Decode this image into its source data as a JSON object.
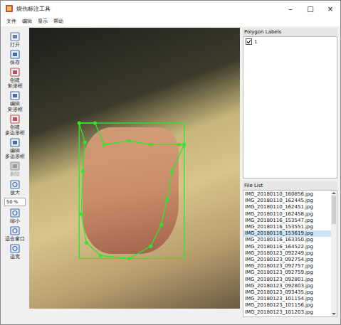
{
  "window": {
    "title": "烧伤标注工具",
    "controls": [
      "–",
      "□",
      "×"
    ]
  },
  "menu": [
    "文件",
    "编辑",
    "显示",
    "帮助"
  ],
  "toolbar": [
    {
      "label": "打开",
      "kind": "button",
      "disabled": false
    },
    {
      "label": "保存",
      "kind": "button",
      "disabled": false
    },
    {
      "label": "创建\n矩形框",
      "kind": "button",
      "disabled": false
    },
    {
      "label": "编辑\n矩形框",
      "kind": "button",
      "disabled": false
    },
    {
      "label": "创建\n多边形框",
      "kind": "button",
      "disabled": false
    },
    {
      "label": "编辑\n多边形框",
      "kind": "button",
      "disabled": false
    },
    {
      "label": "删除",
      "kind": "button",
      "disabled": true
    },
    {
      "label": "放大",
      "kind": "button",
      "disabled": false
    },
    {
      "label": "50 %",
      "kind": "spinbox",
      "disabled": false
    },
    {
      "label": "缩小",
      "kind": "button",
      "disabled": false
    },
    {
      "label": "适合窗口",
      "kind": "button",
      "disabled": false
    },
    {
      "label": "适宽",
      "kind": "button",
      "disabled": false
    }
  ],
  "labels_panel": {
    "title": "Polygon Labels",
    "items": [
      {
        "label": "1",
        "checked": true
      }
    ]
  },
  "file_list": {
    "title": "File List",
    "items": [
      {
        "name": "IMG_20180110_160856.jpg",
        "selected": false
      },
      {
        "name": "IMG_20180110_162445.jpg",
        "selected": false
      },
      {
        "name": "IMG_20180110_162451.jpg",
        "selected": false
      },
      {
        "name": "IMG_20180110_162458.jpg",
        "selected": false
      },
      {
        "name": "IMG_20180116_153547.jpg",
        "selected": false
      },
      {
        "name": "IMG_20180116_153551.jpg",
        "selected": false
      },
      {
        "name": "IMG_20180116_153619.jpg",
        "selected": true
      },
      {
        "name": "IMG_20180116_163350.jpg",
        "selected": false
      },
      {
        "name": "IMG_20180116_164522.jpg",
        "selected": false
      },
      {
        "name": "IMG_20180123_092249.jpg",
        "selected": false
      },
      {
        "name": "IMG_20180123_092754.jpg",
        "selected": false
      },
      {
        "name": "IMG_20180123_092757.jpg",
        "selected": false
      },
      {
        "name": "IMG_20180123_092759.jpg",
        "selected": false
      },
      {
        "name": "IMG_20180123_092801.jpg",
        "selected": false
      },
      {
        "name": "IMG_20180123_092803.jpg",
        "selected": false
      },
      {
        "name": "IMG_20180123_093435.jpg",
        "selected": false
      },
      {
        "name": "IMG_20180123_101154.jpg",
        "selected": false
      },
      {
        "name": "IMG_20180123_101156.jpg",
        "selected": false
      },
      {
        "name": "IMG_20180123_101203.jpg",
        "selected": false
      }
    ]
  }
}
